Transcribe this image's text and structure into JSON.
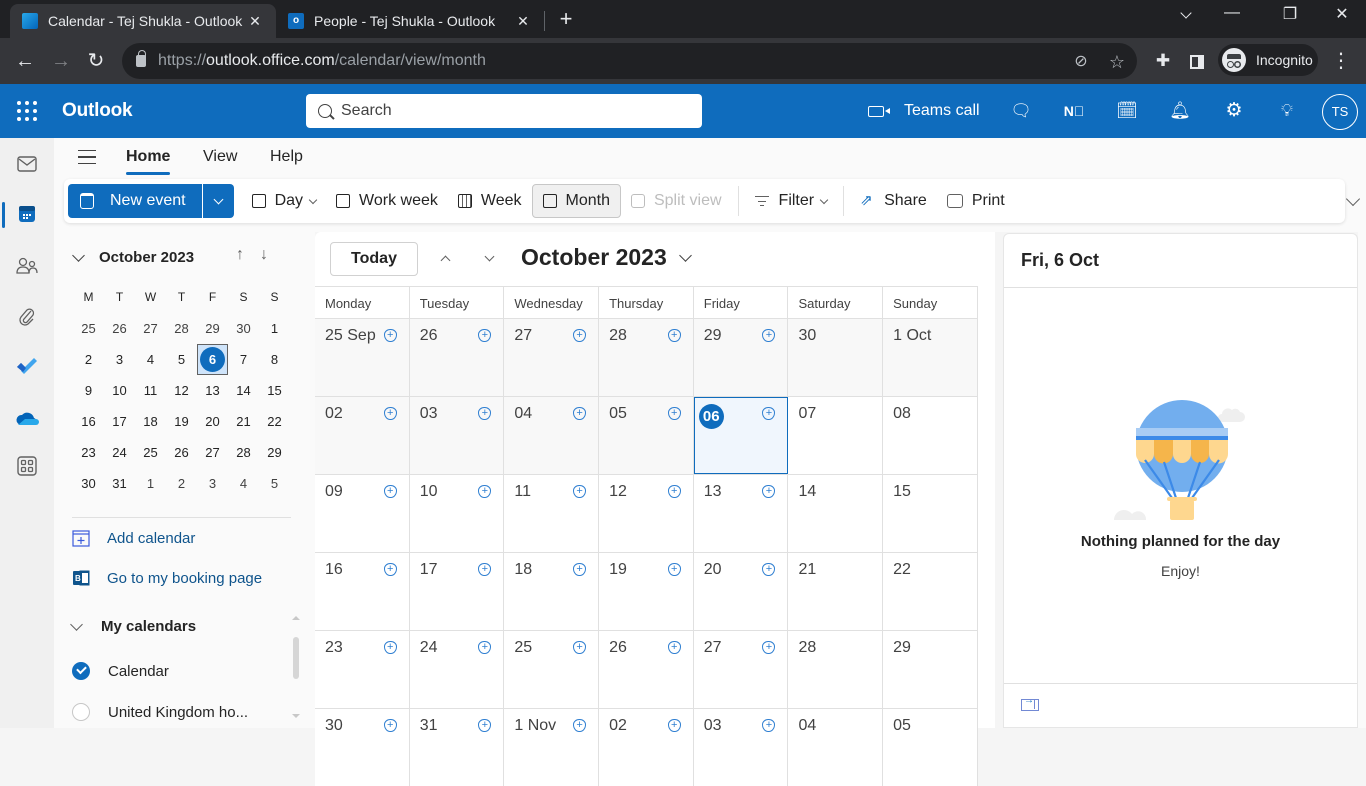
{
  "browser": {
    "tabs": [
      {
        "title": "Calendar - Tej Shukla - Outlook",
        "active": true
      },
      {
        "title": "People - Tej Shukla - Outlook",
        "active": false
      }
    ],
    "url_prefix": "https://",
    "url_domain": "outlook.office.com",
    "url_path": "/calendar/view/month",
    "profile_label": "Incognito",
    "close_glyph": "✕",
    "new_tab_glyph": "+"
  },
  "header": {
    "app_name": "Outlook",
    "search_placeholder": "Search",
    "teams_call_label": "Teams call",
    "avatar_initials": "TS",
    "brand_color": "#0f6cbd"
  },
  "ribbon": {
    "tabs": [
      "Home",
      "View",
      "Help"
    ],
    "active_tab": "Home",
    "new_event_label": "New event",
    "buttons": {
      "day": "Day",
      "work_week": "Work week",
      "week": "Week",
      "month": "Month",
      "split_view": "Split view",
      "filter": "Filter",
      "share": "Share",
      "print": "Print"
    },
    "selected_view": "Month"
  },
  "mini_calendar": {
    "title": "October 2023",
    "weekdays": [
      "M",
      "T",
      "W",
      "T",
      "F",
      "S",
      "S"
    ],
    "weeks": [
      [
        "25",
        "26",
        "27",
        "28",
        "29",
        "30",
        "1"
      ],
      [
        "2",
        "3",
        "4",
        "5",
        "6",
        "7",
        "8"
      ],
      [
        "9",
        "10",
        "11",
        "12",
        "13",
        "14",
        "15"
      ],
      [
        "16",
        "17",
        "18",
        "19",
        "20",
        "21",
        "22"
      ],
      [
        "23",
        "24",
        "25",
        "26",
        "27",
        "28",
        "29"
      ],
      [
        "30",
        "31",
        "1",
        "2",
        "3",
        "4",
        "5"
      ]
    ],
    "selected_day": "6"
  },
  "left_pane": {
    "add_calendar": "Add calendar",
    "booking_page": "Go to my booking page",
    "my_calendars_label": "My calendars",
    "calendars": [
      {
        "name": "Calendar",
        "checked": true
      },
      {
        "name": "United Kingdom ho...",
        "checked": false
      }
    ]
  },
  "month_view": {
    "today_label": "Today",
    "title": "October 2023",
    "weekdays": [
      "Monday",
      "Tuesday",
      "Wednesday",
      "Thursday",
      "Friday",
      "Saturday",
      "Sunday"
    ],
    "weeks": [
      [
        {
          "d": "25 Sep",
          "past": true,
          "add": true
        },
        {
          "d": "26",
          "past": true,
          "add": true
        },
        {
          "d": "27",
          "past": true,
          "add": true
        },
        {
          "d": "28",
          "past": true,
          "add": true
        },
        {
          "d": "29",
          "past": true,
          "add": true
        },
        {
          "d": "30",
          "past": true,
          "add": false
        },
        {
          "d": "1 Oct",
          "past": true,
          "add": false
        }
      ],
      [
        {
          "d": "02",
          "past": true,
          "add": true
        },
        {
          "d": "03",
          "past": true,
          "add": true
        },
        {
          "d": "04",
          "past": true,
          "add": true
        },
        {
          "d": "05",
          "past": true,
          "add": true
        },
        {
          "d": "06",
          "today": true,
          "add": true
        },
        {
          "d": "07",
          "add": false
        },
        {
          "d": "08",
          "add": false
        }
      ],
      [
        {
          "d": "09",
          "add": true
        },
        {
          "d": "10",
          "add": true
        },
        {
          "d": "11",
          "add": true
        },
        {
          "d": "12",
          "add": true
        },
        {
          "d": "13",
          "add": true
        },
        {
          "d": "14",
          "add": false
        },
        {
          "d": "15",
          "add": false
        }
      ],
      [
        {
          "d": "16",
          "add": true
        },
        {
          "d": "17",
          "add": true
        },
        {
          "d": "18",
          "add": true
        },
        {
          "d": "19",
          "add": true
        },
        {
          "d": "20",
          "add": true
        },
        {
          "d": "21",
          "add": false
        },
        {
          "d": "22",
          "add": false
        }
      ],
      [
        {
          "d": "23",
          "add": true
        },
        {
          "d": "24",
          "add": true
        },
        {
          "d": "25",
          "add": true
        },
        {
          "d": "26",
          "add": true
        },
        {
          "d": "27",
          "add": true
        },
        {
          "d": "28",
          "add": false
        },
        {
          "d": "29",
          "add": false
        }
      ],
      [
        {
          "d": "30",
          "add": true
        },
        {
          "d": "31",
          "add": true
        },
        {
          "d": "1 Nov",
          "add": true
        },
        {
          "d": "02",
          "add": true
        },
        {
          "d": "03",
          "add": true
        },
        {
          "d": "04",
          "add": false
        },
        {
          "d": "05",
          "add": false
        }
      ]
    ],
    "add_glyph": "+"
  },
  "day_pane": {
    "title": "Fri, 6 Oct",
    "empty_message": "Nothing planned for the day",
    "empty_sub": "Enjoy!"
  }
}
